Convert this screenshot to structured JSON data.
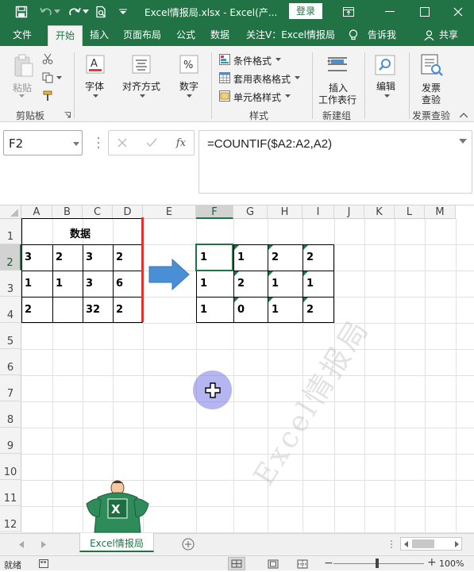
{
  "titlebar": {
    "title": "Excel情报局.xlsx  -  Excel(产...",
    "login": "登录"
  },
  "tabs": [
    "文件",
    "开始",
    "插入",
    "页面布局",
    "公式",
    "数据",
    "关注V：Excel情报局",
    "告诉我",
    "共享"
  ],
  "ribbon": {
    "paste": "粘贴",
    "clipboard_group": "剪贴板",
    "font": "字体",
    "align": "对齐方式",
    "number": "数字",
    "cond": "条件格式",
    "table": "套用表格格式",
    "cellstyle": "单元格样式",
    "styles_group": "样式",
    "insert_ws_line1": "插入",
    "insert_ws_line2": "工作表行",
    "new_group": "新建组",
    "edit": "编辑",
    "invoice_line1": "发票",
    "invoice_line2": "查验",
    "invoice_group": "发票查验"
  },
  "namebox": "F2",
  "formula": "=COUNTIF($A2:A2,A2)",
  "columns": [
    "A",
    "B",
    "C",
    "D",
    "E",
    "F",
    "G",
    "H",
    "I",
    "J",
    "K",
    "L",
    "M"
  ],
  "rows": [
    "1",
    "2",
    "3",
    "4",
    "5",
    "6",
    "7",
    "8",
    "9",
    "10",
    "11",
    "12"
  ],
  "header_title": "数据",
  "src": [
    [
      "3",
      "2",
      "3",
      "2"
    ],
    [
      "1",
      "1",
      "3",
      "6"
    ],
    [
      "2",
      "",
      "32",
      "2"
    ]
  ],
  "result": [
    [
      "1",
      "1",
      "2",
      "2"
    ],
    [
      "1",
      "2",
      "1",
      "1"
    ],
    [
      "1",
      "0",
      "1",
      "2"
    ]
  ],
  "watermark": "Excel情报局",
  "sheet_tab": "Excel情报局",
  "status": {
    "ready": "就绪",
    "zoom": "100%"
  },
  "colors": {
    "accent": "#217346",
    "arrow": "#4a8fd6",
    "red_line": "#e03030",
    "cursor_circle": "#7878e6"
  }
}
